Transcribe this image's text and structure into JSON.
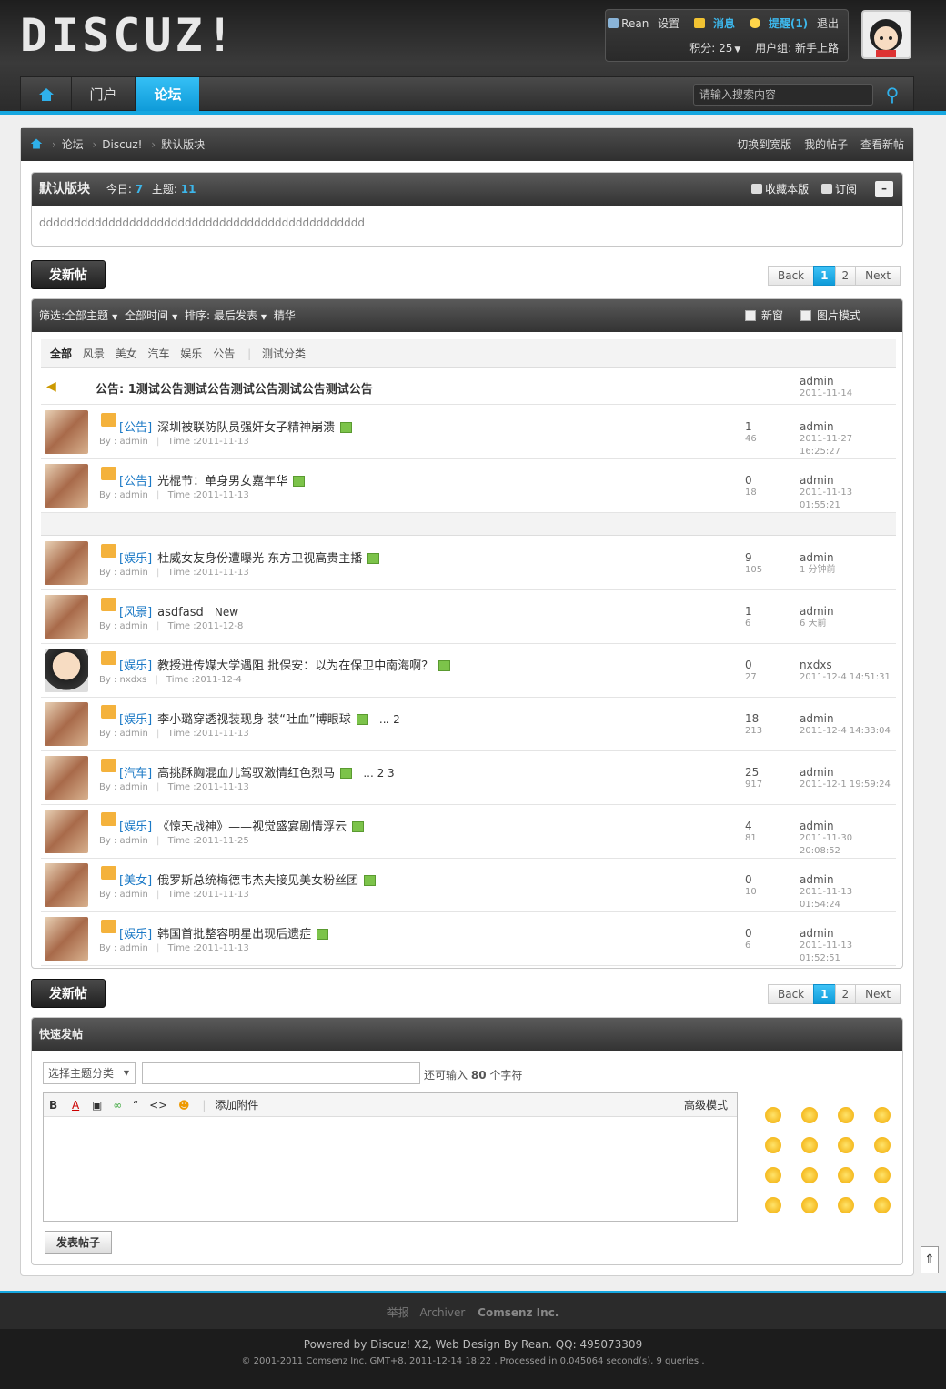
{
  "header": {
    "logo": "DISCUZ!",
    "user": "Rean",
    "settings": "设置",
    "messages": "消息",
    "alerts": "提醒(1)",
    "logout": "退出",
    "credits": "积分: 25",
    "group": "用户组: 新手上路"
  },
  "nav": {
    "portal": "门户",
    "forum": "论坛",
    "search_placeholder": "请输入搜索内容"
  },
  "breadcrumb": {
    "items": [
      "论坛",
      "Discuz!",
      "默认版块"
    ],
    "links": [
      "切换到宽版",
      "我的帖子",
      "查看新帖"
    ]
  },
  "forum": {
    "name": "默认版块",
    "today_label": "今日:",
    "today": "7",
    "threads_label": "主题:",
    "threads": "11",
    "favorite": "收藏本版",
    "subscribe": "订阅",
    "desc": "ddddddddddddddddddddddddddddddddddddddddddddddd"
  },
  "toolbar": {
    "new_post": "发新帖",
    "back": "Back",
    "page1": "1",
    "page2": "2",
    "next": "Next"
  },
  "filter": {
    "label": "筛选:",
    "all": "全部主题",
    "time": "全部时间",
    "sort": "排序: 最后发表",
    "digest": "精华",
    "new_window": "新窗",
    "image_mode": "图片模式"
  },
  "tabs": [
    "全部",
    "风景",
    "美女",
    "汽车",
    "娱乐",
    "公告",
    "测试分类"
  ],
  "announcement": {
    "prefix": "公告:",
    "text": "1测试公告测试公告测试公告测试公告测试公告",
    "author": "admin",
    "date": "2011-11-14"
  },
  "threads": [
    {
      "cat": "[公告]",
      "title": "深圳被联防队员强奸女子精神崩溃",
      "by": "admin",
      "time": "2011-11-13",
      "replies": "1",
      "views": "46",
      "last_user": "admin",
      "last_time": "2011-11-27 16:25:27",
      "extra": ""
    },
    {
      "cat": "[公告]",
      "title": "光棍节：单身男女嘉年华",
      "by": "admin",
      "time": "2011-11-13",
      "replies": "0",
      "views": "18",
      "last_user": "admin",
      "last_time": "2011-11-13 01:55:21",
      "extra": ""
    },
    {
      "cat": "[娱乐]",
      "title": "杜威女友身份遭曝光 东方卫视高贵主播",
      "by": "admin",
      "time": "2011-11-13",
      "replies": "9",
      "views": "105",
      "last_user": "admin",
      "last_time": "1 分钟前",
      "extra": ""
    },
    {
      "cat": "[风景]",
      "title": "asdfasd",
      "by": "admin",
      "time": "2011-12-8",
      "replies": "1",
      "views": "6",
      "last_user": "admin",
      "last_time": "6 天前",
      "extra": "New"
    },
    {
      "cat": "[娱乐]",
      "title": "教授进传媒大学遇阻 批保安：以为在保卫中南海啊？",
      "by": "nxdxs",
      "time": "2011-12-4",
      "replies": "0",
      "views": "27",
      "last_user": "nxdxs",
      "last_time": "2011-12-4 14:51:31",
      "extra": ""
    },
    {
      "cat": "[娱乐]",
      "title": "李小璐穿透视装现身 装“吐血”博眼球",
      "by": "admin",
      "time": "2011-11-13",
      "replies": "18",
      "views": "213",
      "last_user": "admin",
      "last_time": "2011-12-4 14:33:04",
      "extra": "... 2"
    },
    {
      "cat": "[汽车]",
      "title": "高挑酥胸混血儿驾驭激情红色烈马",
      "by": "admin",
      "time": "2011-11-13",
      "replies": "25",
      "views": "917",
      "last_user": "admin",
      "last_time": "2011-12-1 19:59:24",
      "extra": "... 2  3"
    },
    {
      "cat": "[娱乐]",
      "title": "《惊天战神》——视觉盛宴剧情浮云",
      "by": "admin",
      "time": "2011-11-25",
      "replies": "4",
      "views": "81",
      "last_user": "admin",
      "last_time": "2011-11-30 20:08:52",
      "extra": ""
    },
    {
      "cat": "[美女]",
      "title": "俄罗斯总统梅德韦杰夫接见美女粉丝团",
      "by": "admin",
      "time": "2011-11-13",
      "replies": "0",
      "views": "10",
      "last_user": "admin",
      "last_time": "2011-11-13 01:54:24",
      "extra": ""
    },
    {
      "cat": "[娱乐]",
      "title": "韩国首批整容明星出现后遗症",
      "by": "admin",
      "time": "2011-11-13",
      "replies": "0",
      "views": "6",
      "last_user": "admin",
      "last_time": "2011-11-13 01:52:51",
      "extra": ""
    }
  ],
  "labels": {
    "by": "By :",
    "time": "Time :"
  },
  "quick": {
    "title": "快速发帖",
    "select": "选择主题分类",
    "remain_pre": "还可输入",
    "remain": "80",
    "remain_post": "个字符",
    "attach": "添加附件",
    "advanced": "高级模式",
    "submit": "发表帖子"
  },
  "footer": {
    "report": "举报",
    "archiver": "Archiver",
    "company": "Comsenz Inc.",
    "powered": "Powered by Discuz! X2, Web Design By Rean. QQ: 495073309",
    "copyright": "© 2001-2011 Comsenz Inc. GMT+8, 2011-12-14 18:22 , Processed in 0.045064 second(s), 9 queries ."
  }
}
